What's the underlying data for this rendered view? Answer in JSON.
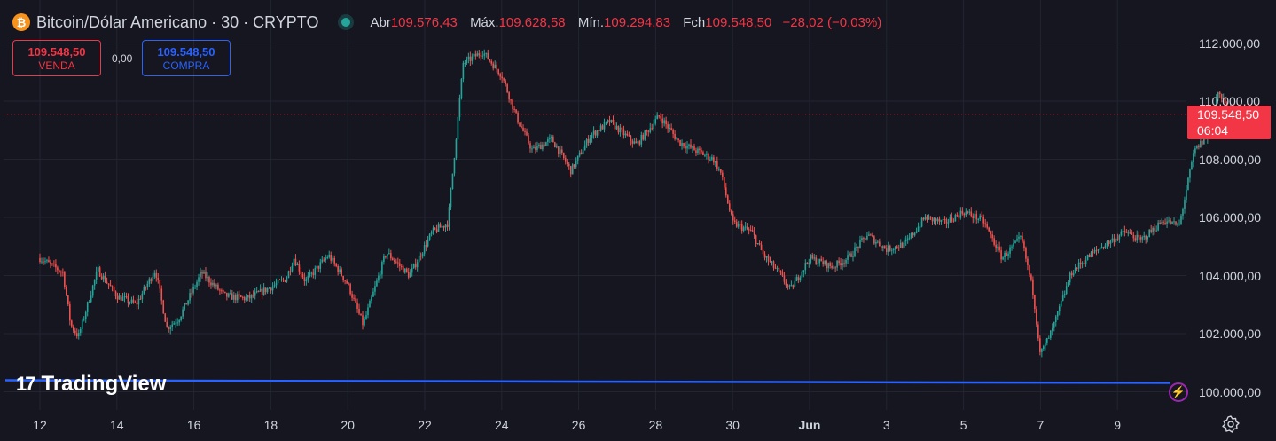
{
  "header": {
    "icon_glyph": "₿",
    "symbol_title": "Bitcoin/Dólar Americano · 30 · CRYPTO",
    "open_label": "Abr",
    "open_value": "109.576,43",
    "high_label": "Máx.",
    "high_value": "109.628,58",
    "low_label": "Mín.",
    "low_value": "109.294,83",
    "close_label": "Fch",
    "close_value": "109.548,50",
    "change": "−28,02 (−0,03%)"
  },
  "trade": {
    "sell_price": "109.548,50",
    "sell_label": "VENDA",
    "spread": "0,00",
    "buy_price": "109.548,50",
    "buy_label": "COMPRA"
  },
  "watermark": {
    "logo_glyph": "17",
    "text": "TradingView"
  },
  "price_axis": {
    "current_price": "109.548,50",
    "countdown": "06:04",
    "ticks": [
      "112.000,00",
      "110.000,00",
      "108.000,00",
      "106.000,00",
      "104.000,00",
      "102.000,00",
      "100.000,00"
    ]
  },
  "time_axis": {
    "ticks": [
      "12",
      "14",
      "16",
      "18",
      "20",
      "22",
      "24",
      "26",
      "28",
      "30",
      "Jun",
      "3",
      "5",
      "7",
      "9"
    ]
  },
  "colors": {
    "background": "#151620",
    "up": "#26a69a",
    "down": "#ef5350",
    "accent_blue": "#2962ff",
    "price_tag": "#f23645"
  },
  "icons": {
    "status": "market-open-dot",
    "flash": "lightning-icon",
    "settings": "gear-icon"
  },
  "chart_data": {
    "type": "candlestick",
    "symbol": "Bitcoin/Dólar Americano",
    "interval": "30",
    "ylim": [
      99500,
      112600
    ],
    "current_price": 109548.5,
    "horizontal_line": {
      "value": 100350,
      "color": "#2962ff"
    },
    "x": [
      "12",
      "14",
      "16",
      "18",
      "20",
      "22",
      "24",
      "26",
      "28",
      "30",
      "Jun",
      "3",
      "5",
      "7",
      "9"
    ],
    "path": [
      [
        0,
        104600
      ],
      [
        0.6,
        104100
      ],
      [
        0.8,
        102300
      ],
      [
        1.0,
        101900
      ],
      [
        1.5,
        104200
      ],
      [
        2.0,
        103300
      ],
      [
        2.5,
        103000
      ],
      [
        3.0,
        104200
      ],
      [
        3.3,
        102200
      ],
      [
        3.6,
        102500
      ],
      [
        4.2,
        104100
      ],
      [
        4.8,
        103300
      ],
      [
        5.4,
        103200
      ],
      [
        6.0,
        103600
      ],
      [
        6.4,
        103900
      ],
      [
        6.6,
        104600
      ],
      [
        6.9,
        103800
      ],
      [
        7.5,
        104700
      ],
      [
        8.0,
        103700
      ],
      [
        8.4,
        102300
      ],
      [
        9.0,
        104800
      ],
      [
        9.6,
        104000
      ],
      [
        10.2,
        105500
      ],
      [
        10.6,
        105800
      ],
      [
        11.0,
        111300
      ],
      [
        11.5,
        111700
      ],
      [
        12.0,
        110900
      ],
      [
        12.4,
        109400
      ],
      [
        12.8,
        108300
      ],
      [
        13.3,
        108700
      ],
      [
        13.8,
        107600
      ],
      [
        14.3,
        108800
      ],
      [
        14.8,
        109300
      ],
      [
        15.5,
        108500
      ],
      [
        16.1,
        109500
      ],
      [
        16.6,
        108600
      ],
      [
        17.5,
        108000
      ],
      [
        17.7,
        107500
      ],
      [
        18.0,
        105800
      ],
      [
        18.5,
        105500
      ],
      [
        18.8,
        104700
      ],
      [
        19.2,
        104100
      ],
      [
        19.5,
        103500
      ],
      [
        20.0,
        104600
      ],
      [
        20.6,
        104300
      ],
      [
        21.0,
        104600
      ],
      [
        21.5,
        105400
      ],
      [
        22.0,
        104900
      ],
      [
        22.5,
        105100
      ],
      [
        23.0,
        106000
      ],
      [
        23.5,
        105800
      ],
      [
        24.0,
        106200
      ],
      [
        24.5,
        105900
      ],
      [
        25.0,
        104600
      ],
      [
        25.5,
        105300
      ],
      [
        25.8,
        103500
      ],
      [
        26.0,
        101300
      ],
      [
        26.3,
        102100
      ],
      [
        26.8,
        104100
      ],
      [
        27.2,
        104600
      ],
      [
        27.6,
        105000
      ],
      [
        28.2,
        105500
      ],
      [
        28.6,
        105200
      ],
      [
        29.2,
        105900
      ],
      [
        29.6,
        105700
      ],
      [
        30.0,
        108300
      ],
      [
        30.4,
        108900
      ],
      [
        30.6,
        110300
      ],
      [
        31.0,
        109500
      ],
      [
        31.3,
        109700
      ],
      [
        31.6,
        109200
      ]
    ]
  }
}
